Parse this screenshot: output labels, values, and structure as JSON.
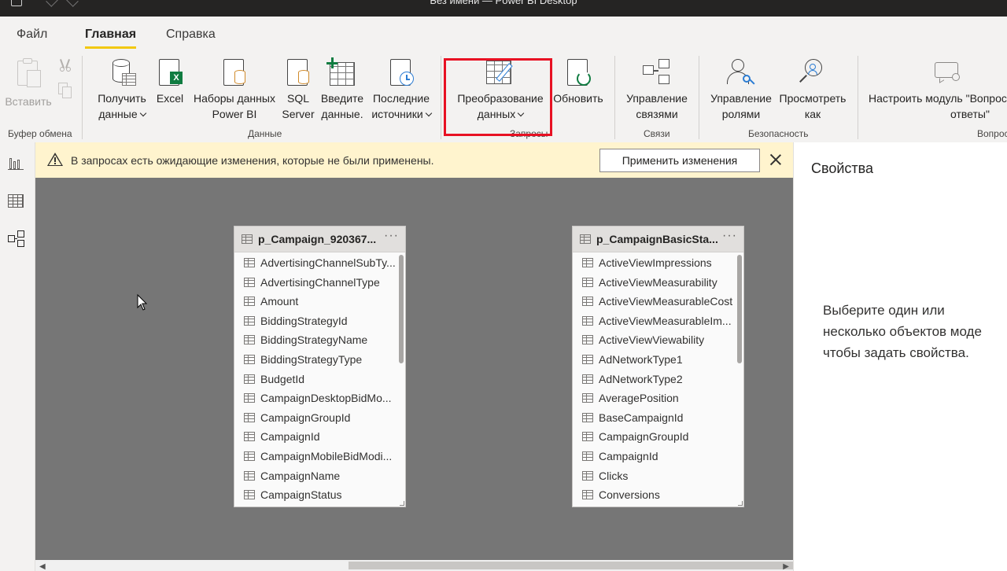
{
  "app": {
    "window_title": "Без имени — Power BI Desktop"
  },
  "menu": {
    "tabs": [
      {
        "label": "Файл"
      },
      {
        "label": "Главная"
      },
      {
        "label": "Справка"
      }
    ]
  },
  "ribbon": {
    "clipboard": {
      "paste": "Вставить",
      "group": "Буфер обмена"
    },
    "data": {
      "get_data_1": "Получить",
      "get_data_2": "данные",
      "excel": "Excel",
      "datasets_1": "Наборы данных",
      "datasets_2": "Power BI",
      "sql_1": "SQL",
      "sql_2": "Server",
      "enter_1": "Введите",
      "enter_2": "данные.",
      "recent_1": "Последние",
      "recent_2": "источники",
      "group": "Данные"
    },
    "queries": {
      "transform_1": "Преобразование",
      "transform_2": "данных",
      "refresh": "Обновить",
      "group": "Запросы"
    },
    "relations": {
      "manage_1": "Управление",
      "manage_2": "связями",
      "group": "Связи"
    },
    "security": {
      "roles_1": "Управление",
      "roles_2": "ролями",
      "view_as_1": "Просмотреть",
      "view_as_2": "как",
      "group": "Безопасность"
    },
    "qa": {
      "setup_1": "Настроить модуль \"Вопрос",
      "setup_2": "ответы\"",
      "group": "Вопрос"
    }
  },
  "warning": {
    "text": "В запросах есть ожидающие изменения, которые не были применены.",
    "apply_button": "Применить изменения"
  },
  "tables": [
    {
      "name": "p_Campaign_920367...",
      "fields": [
        "AdvertisingChannelSubTy...",
        "AdvertisingChannelType",
        "Amount",
        "BiddingStrategyId",
        "BiddingStrategyName",
        "BiddingStrategyType",
        "BudgetId",
        "CampaignDesktopBidMo...",
        "CampaignGroupId",
        "CampaignId",
        "CampaignMobileBidModi...",
        "CampaignName",
        "CampaignStatus"
      ]
    },
    {
      "name": "p_CampaignBasicSta...",
      "fields": [
        "ActiveViewImpressions",
        "ActiveViewMeasurability",
        "ActiveViewMeasurableCost",
        "ActiveViewMeasurableIm...",
        "ActiveViewViewability",
        "AdNetworkType1",
        "AdNetworkType2",
        "AveragePosition",
        "BaseCampaignId",
        "CampaignGroupId",
        "CampaignId",
        "Clicks",
        "Conversions"
      ]
    }
  ],
  "properties": {
    "title": "Свойства",
    "message": "Выберите один или\nнесколько объектов моде\nчтобы задать свойства."
  },
  "colors": {
    "accent_tab": "#f2c811",
    "highlight_box": "#e81123",
    "warning_bg": "#fff4ce",
    "canvas_bg": "#767676"
  }
}
